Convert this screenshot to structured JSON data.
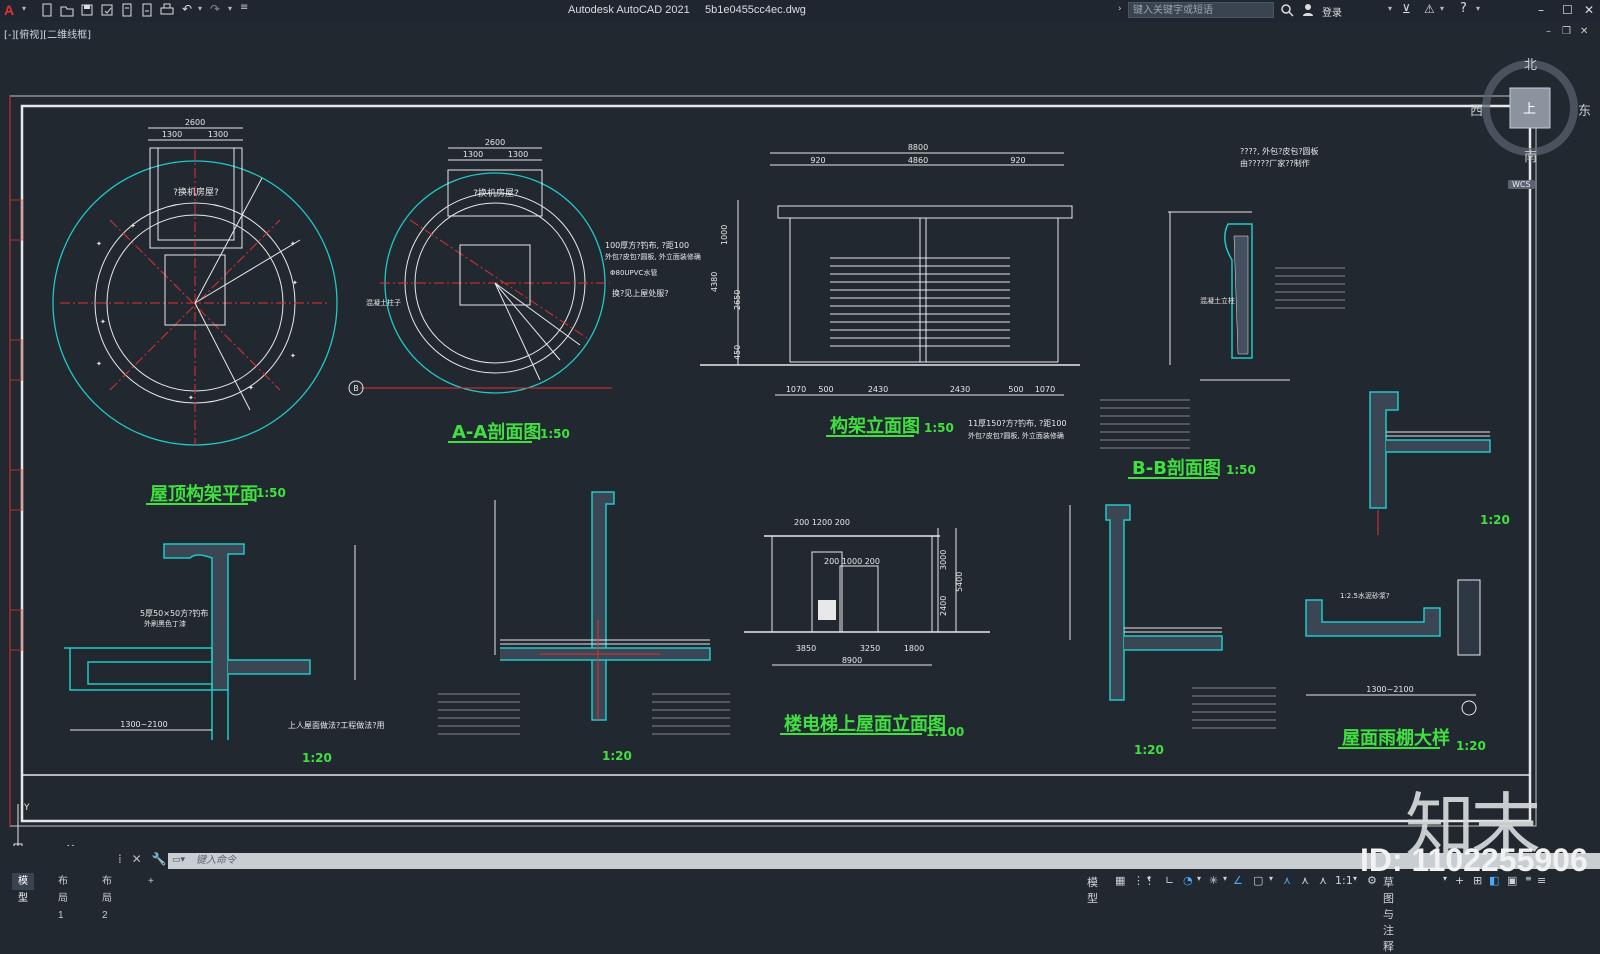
{
  "app": {
    "title": "Autodesk AutoCAD 2021",
    "filename": "5b1e0455cc4ec.dwg",
    "search_placeholder": "键入关键字或短语",
    "login_label": "登录",
    "view_label": "[-][俯视][二维线框]"
  },
  "viewcube": {
    "north": "北",
    "south": "南",
    "east": "东",
    "west": "西",
    "top": "上",
    "wcs": "WCS"
  },
  "drawing": {
    "titles": [
      {
        "text": "屋顶构架平面",
        "scale": "1:50"
      },
      {
        "text": "A-A剖面图",
        "scale": "1:50"
      },
      {
        "text": "构架立面图",
        "scale": "1:50"
      },
      {
        "text": "B-B剖面图",
        "scale": "1:50"
      },
      {
        "text": "楼电梯上屋面立面图",
        "scale": "1:100"
      },
      {
        "text": "屋面雨棚大样",
        "scale": "1:20"
      }
    ],
    "detail_scales": [
      "1:20",
      "1:20",
      "1:20",
      "1:20"
    ],
    "dims": {
      "plan_top": "2600",
      "plan_half1": "1300",
      "plan_half2": "1300",
      "aa_top": "2600",
      "aa_half1": "1300",
      "aa_half2": "1300",
      "elev_total": "8800",
      "elev_4860": "4860",
      "elev_920a": "920",
      "elev_920b": "920",
      "elev_bottom": [
        "1070",
        "500",
        "2430",
        "2430",
        "500",
        "1070"
      ],
      "elev_side": [
        "1000",
        "4380",
        "2650",
        "450"
      ],
      "lift_total": "8900",
      "lift_dims": [
        "3850",
        "3250",
        "1800"
      ],
      "lift_top": "200 1200 200",
      "lift_mid": "200 1000 200",
      "lift_side": [
        "3000",
        "5400",
        "2400"
      ],
      "canopy_dim": "1300~2100",
      "detail1_dim": "1300~2100"
    },
    "notes": {
      "plan_room": "?换机房屋?",
      "aa_room": "?换机房屋?",
      "aa_note1": "100厚方?钓布, ?距100",
      "aa_note2": "外包?皮包?圆板, 外立面装修确",
      "aa_note3": "Φ80UPVC水管",
      "aa_note4": "换?见上屋处服?",
      "aa_note5": "混凝土柱子",
      "elev_note1": "11厚150?方?钓布, ?距100",
      "elev_note2": "外包?皮包?圆板, 外立面装修确",
      "bb_note1": "????, 外包?皮包?圆板",
      "bb_note2": "由?????厂家??制作",
      "bb_note3": "混凝土立柱",
      "detail1_note": "5厚50×50方?钓布",
      "detail1_note2": "外刷黑色丁漆",
      "detail1_note3": "上人屋面做法?工程做法?用",
      "canopy_note": "1:2.5水泥砂浆?"
    }
  },
  "command": {
    "placeholder": "键入命令"
  },
  "layout_tabs": [
    "模型",
    "布局1",
    "布局2",
    "+"
  ],
  "status": {
    "model": "模型",
    "scale": "1:1",
    "workspace": "草图与注释"
  },
  "watermark": {
    "brand": "知末",
    "id": "ID: 1102255906"
  },
  "colors": {
    "background": "#212830",
    "line_white": "#e8e8e8",
    "line_cyan": "#20c8c8",
    "line_green": "#40e040",
    "line_red": "#e03030",
    "accent": "#e03030"
  }
}
